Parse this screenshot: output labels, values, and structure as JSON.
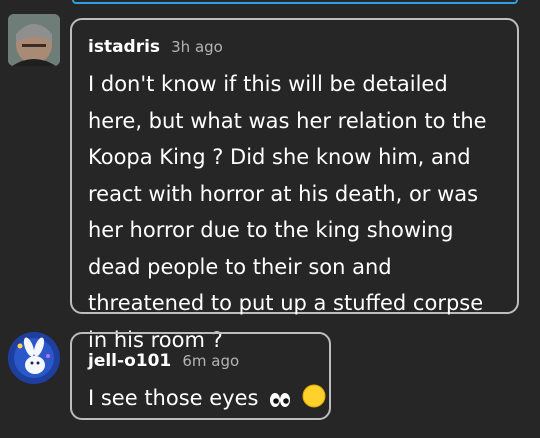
{
  "comments": [
    {
      "username": "istadris",
      "timestamp": "3h ago",
      "text": "I don't know if this will be detailed here, but what was her relation to the Koopa King ? Did she know him, and react with horror at his death, or was her horror due to the king showing dead people to their son and threatened to put up a stuffed corpse in his room ?"
    },
    {
      "username": "jell-o101",
      "timestamp": "6m ago",
      "text": "I see those eyes",
      "emoji": [
        "eyes-emoji",
        "smiley-face-emoji"
      ]
    }
  ],
  "colors": {
    "background": "#262626",
    "bubble_border": "#bdbdbd",
    "accent": "#2f9fe6",
    "timestamp": "#b3b3b3"
  }
}
